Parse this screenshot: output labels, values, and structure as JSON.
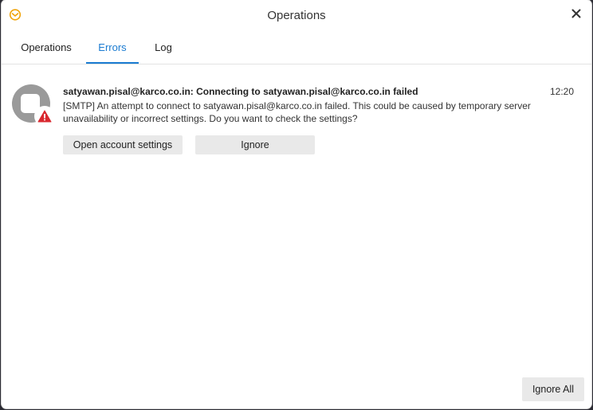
{
  "window": {
    "title": "Operations"
  },
  "tabs": [
    {
      "label": "Operations",
      "active": false
    },
    {
      "label": "Errors",
      "active": true
    },
    {
      "label": "Log",
      "active": false
    }
  ],
  "error": {
    "title": "satyawan.pisal@karco.co.in: Connecting to satyawan.pisal@karco.co.in failed",
    "time": "12:20",
    "message": "[SMTP] An attempt to connect to satyawan.pisal@karco.co.in failed. This could be caused by temporary server unavailability or incorrect settings. Do you want to check the settings?",
    "actions": {
      "open_settings": "Open account settings",
      "ignore": "Ignore"
    }
  },
  "footer": {
    "ignore_all": "Ignore All"
  },
  "colors": {
    "accent": "#1a7bd1",
    "warning": "#d9282f",
    "app_icon": "#f0a30a"
  },
  "icons": {
    "app": "em-client-logo-icon",
    "close": "close-icon",
    "avatar": "account-avatar-icon",
    "warning": "warning-triangle-icon"
  }
}
